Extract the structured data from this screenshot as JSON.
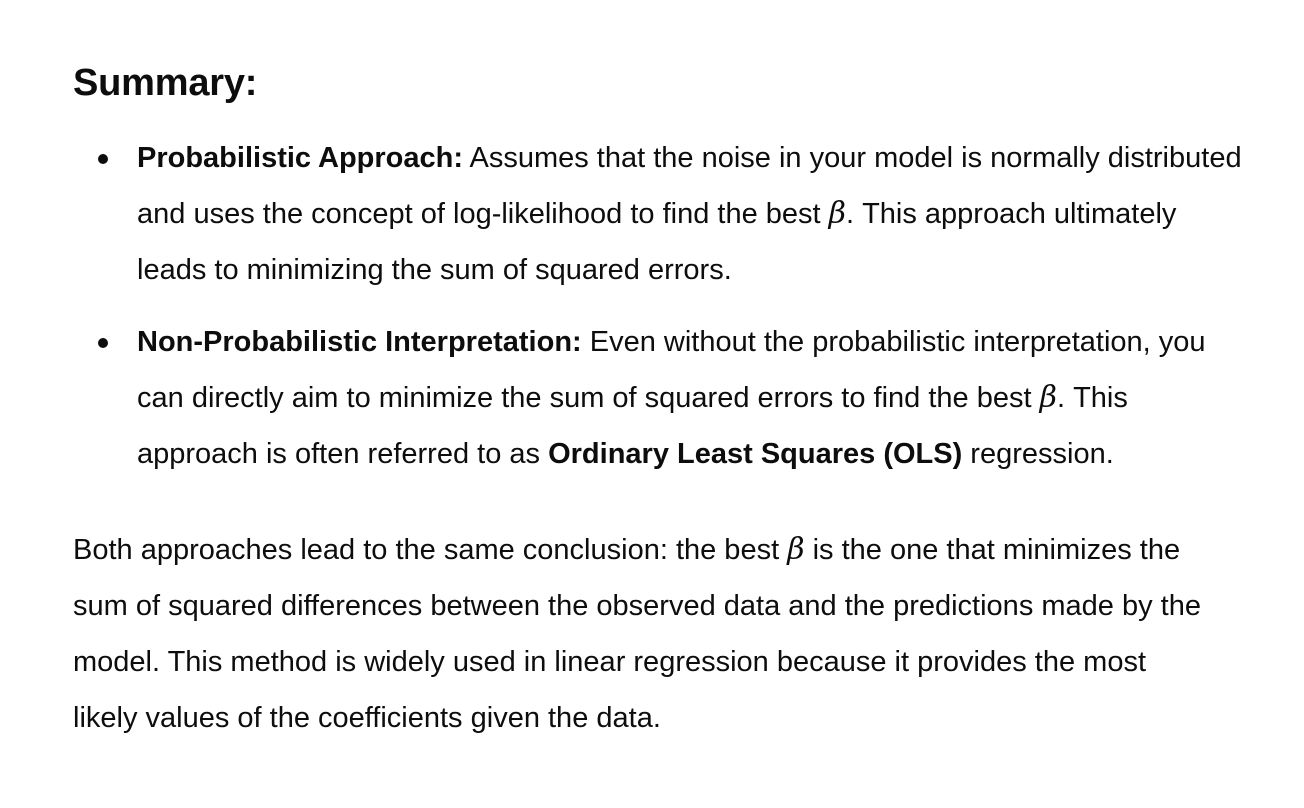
{
  "heading": "Summary:",
  "beta_symbol": "β",
  "items": [
    {
      "term": "Probabilistic Approach:",
      "text_before_beta": " Assumes that the noise in your model is normally distributed and uses the concept of log-likelihood to find the best ",
      "text_after_beta": ". This approach ultimately leads to minimizing the sum of squared errors."
    },
    {
      "term": "Non-Probabilistic Interpretation:",
      "text_before_beta": " Even without the probabilistic interpretation, you can directly aim to minimize the sum of squared errors to find the best ",
      "text_after_beta": ". This approach is often referred to as ",
      "emphasis": "Ordinary Least Squares (OLS)",
      "text_end": " regression."
    }
  ],
  "conclusion": {
    "text_before_beta": "Both approaches lead to the same conclusion: the best ",
    "text_after_beta": " is the one that minimizes the sum of squared differences between the observed data and the predictions made by the model. This method is widely used in linear regression because it provides the most likely values of the coefficients given the data."
  }
}
